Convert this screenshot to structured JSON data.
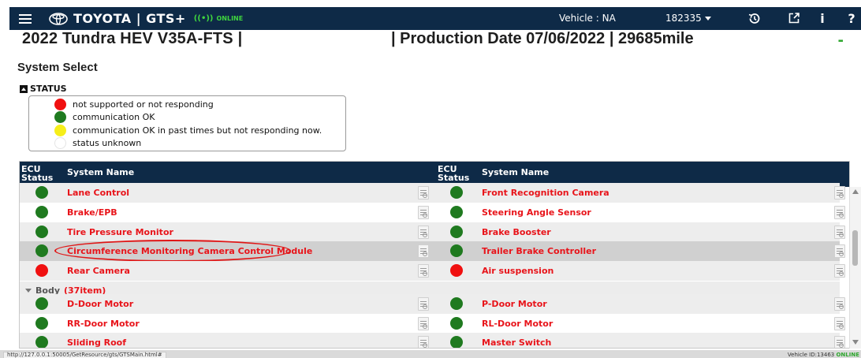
{
  "topbar": {
    "brand": "TOYOTA | GTS+",
    "online_label": "ONLINE",
    "online_icon": "broadcast-icon",
    "vehicle": "Vehicle : NA",
    "vin": "182335",
    "icons": [
      "history-icon",
      "external-link-icon",
      "info-icon",
      "help-icon"
    ],
    "info_glyph": "i",
    "help_glyph": "?"
  },
  "header": {
    "title_left": "2022 Tundra HEV V35A-FTS   |",
    "title_right": "|  Production Date 07/06/2022   |   29685mile",
    "title_dash": "-"
  },
  "page_title": "System Select",
  "status": {
    "label": "STATUS",
    "legend": [
      {
        "color": "#f01010",
        "text": "not supported or not responding"
      },
      {
        "color": "#1f7a1f",
        "text": "communication OK"
      },
      {
        "color": "#f6ee1a",
        "text": "communication OK in past times but not responding now."
      },
      {
        "color": "#ffffff",
        "text": "status unknown"
      }
    ]
  },
  "table": {
    "headers": {
      "ecu_status_1": "ECU",
      "ecu_status_2": "Status",
      "system_name": "System Name"
    },
    "rows": [
      {
        "left": {
          "status": "green",
          "name": "Lane Control"
        },
        "right": {
          "status": "green",
          "name": "Front Recognition Camera"
        }
      },
      {
        "left": {
          "status": "green",
          "name": "Brake/EPB"
        },
        "right": {
          "status": "green",
          "name": "Steering Angle Sensor"
        }
      },
      {
        "left": {
          "status": "green",
          "name": "Tire Pressure Monitor"
        },
        "right": {
          "status": "green",
          "name": "Brake Booster"
        }
      },
      {
        "left": {
          "status": "green",
          "name": "Circumference Monitoring Camera Control Module"
        },
        "right": {
          "status": "green",
          "name": "Trailer Brake Controller"
        }
      },
      {
        "left": {
          "status": "red",
          "name": "Rear Camera"
        },
        "right": {
          "status": "red",
          "name": "Air suspension"
        }
      }
    ],
    "group": {
      "label": "Body",
      "count": "(37item)"
    },
    "body_rows": [
      {
        "left": {
          "status": "green",
          "name": "D-Door Motor"
        },
        "right": {
          "status": "green",
          "name": "P-Door Motor"
        }
      },
      {
        "left": {
          "status": "green",
          "name": "RR-Door Motor"
        },
        "right": {
          "status": "green",
          "name": "RL-Door Motor"
        }
      },
      {
        "left": {
          "status": "green",
          "name": "Sliding Roof"
        },
        "right": {
          "status": "green",
          "name": "Master Switch"
        }
      }
    ]
  },
  "statusbar": {
    "url": "http://127.0.0.1:50005/GetResource/gts/GTSMain.html#",
    "right": "Vehicle ID:13463",
    "right_online": "ONLINE"
  }
}
